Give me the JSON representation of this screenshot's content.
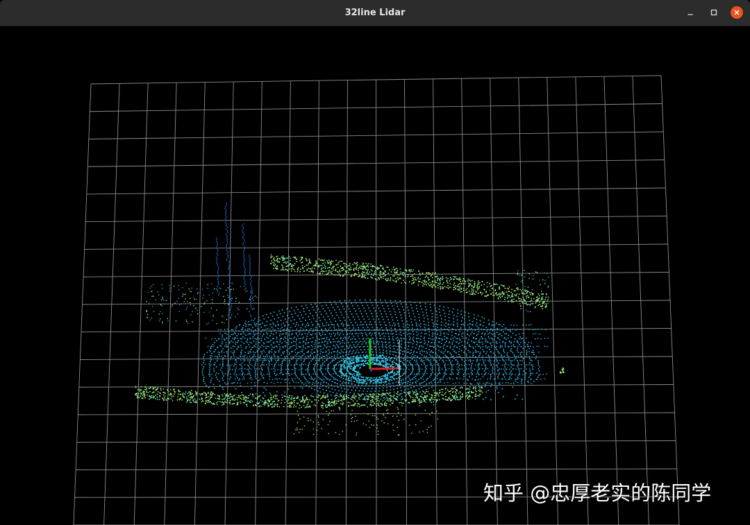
{
  "window": {
    "title": "32line Lidar",
    "controls": {
      "minimize_icon": "minimize-icon",
      "maximize_icon": "maximize-icon",
      "close_icon": "close-icon",
      "close_color": "#e95420"
    }
  },
  "viewport": {
    "background": "#000000",
    "grid_color": "#8c8c8c",
    "point_colors": [
      "#2aa6d9",
      "#34c8e8",
      "#5ee6c8",
      "#9ef07a",
      "#c8f060",
      "#1f6fd0"
    ],
    "axes": {
      "x_color": "#e02020",
      "y_color": "#20d020",
      "z_color": "#2040ff"
    }
  },
  "watermark": {
    "text": "知乎 @忠厚老实的陈同学"
  }
}
